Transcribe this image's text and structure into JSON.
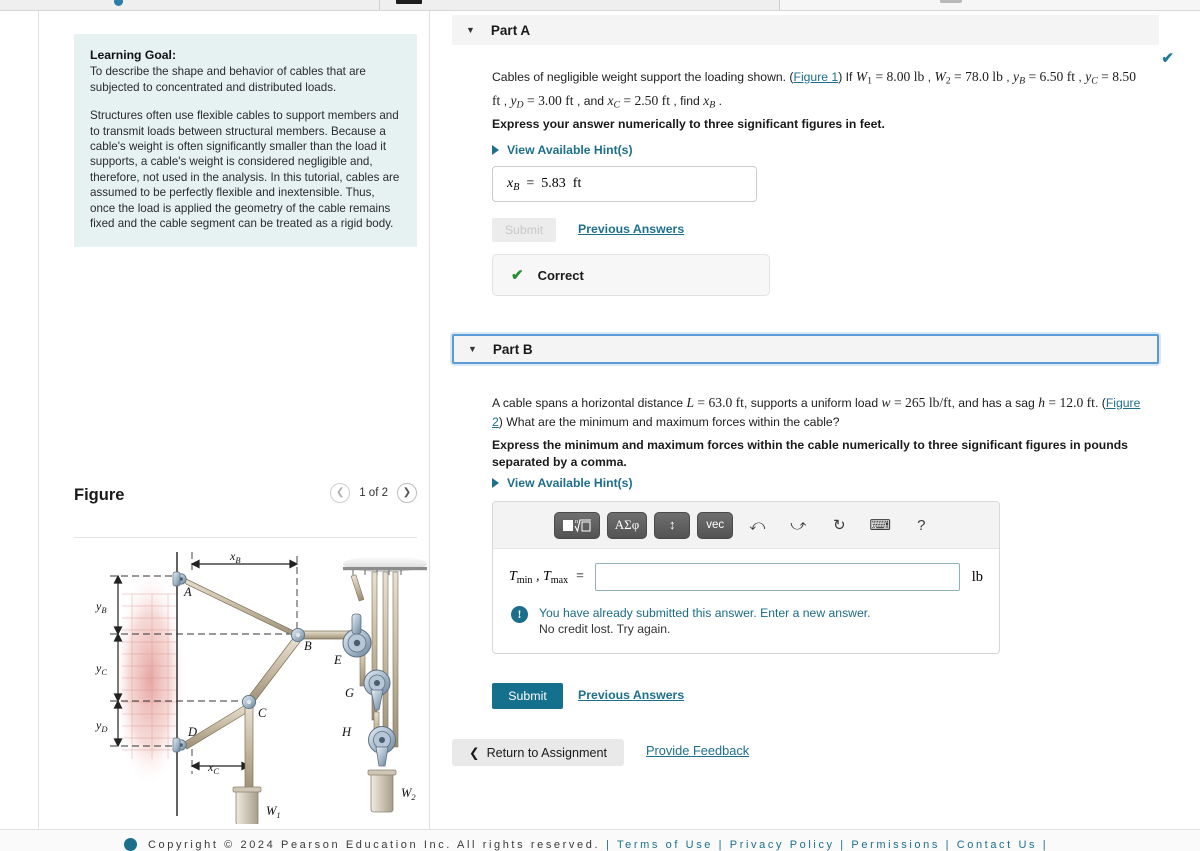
{
  "learning_goal": {
    "title": "Learning Goal:",
    "para1": "To describe the shape and behavior of cables that are subjected to concentrated and distributed loads.",
    "para2": "Structures often use flexible cables to support members and to transmit loads between structural members.  Because a cable's weight is often significantly smaller than the load it supports, a cable's weight is considered negligible and, therefore, not used in the analysis. In this tutorial, cables are assumed to be perfectly flexible and inextensible. Thus, once the load is applied the geometry of the cable remains fixed and the cable segment can be treated as a rigid body."
  },
  "figure_panel": {
    "title": "Figure",
    "counter": "1 of 2",
    "prev_icon": "chevron-left-icon",
    "next_icon": "chevron-right-icon",
    "diagram": {
      "wall_label": "brick-wall",
      "points": [
        "A",
        "B",
        "C",
        "D",
        "E",
        "G",
        "H"
      ],
      "dim_labels": [
        "xB",
        "xC",
        "yB",
        "yC",
        "yD"
      ],
      "weights": [
        "W1",
        "W2"
      ]
    }
  },
  "part_a": {
    "caret_icon": "caret-down-icon",
    "title": "Part A",
    "status_icon": "check-icon",
    "question_pre": "Cables of negligible weight support the loading shown. (",
    "figure_link": "Figure 1",
    "question_post": ") If",
    "givens": [
      {
        "sym": "W",
        "sub": "1",
        "val": "= 8.00 lb"
      },
      {
        "sym": "W",
        "sub": "2",
        "val": "= 78.0 lb"
      },
      {
        "sym": "y",
        "sub": "B",
        "val": "= 6.50 ft"
      },
      {
        "sym": "y",
        "sub": "C",
        "val": "= 8.50 ft"
      },
      {
        "sym": "y",
        "sub": "D",
        "val": "= 3.00 ft"
      }
    ],
    "and_text": ", and",
    "given_last": {
      "sym": "x",
      "sub": "C",
      "val": "= 2.50 ft"
    },
    "find_text": ", find",
    "find_sym": {
      "sym": "x",
      "sub": "B"
    },
    "instruction": "Express your answer numerically to three significant figures in feet.",
    "hint_label": "View Available Hint(s)",
    "answer_label_sym": "x",
    "answer_label_sub": "B",
    "answer_eq": "=",
    "answer_value": "5.83",
    "answer_unit": "ft",
    "submit_label": "Submit",
    "previous_answers_label": "Previous Answers",
    "result_label": "Correct"
  },
  "part_b": {
    "caret_icon": "caret-down-icon",
    "title": "Part B",
    "q_seg1": "A cable spans a horizontal distance",
    "q_L": {
      "sym": "L",
      "val": "= 63.0 ft"
    },
    "q_seg2": ", supports a uniform load",
    "q_w": {
      "sym": "w",
      "val": "= 265 lb/ft"
    },
    "q_seg3": ", and has a sag",
    "q_h": {
      "sym": "h",
      "val": "= 12.0 ft"
    },
    "q_seg4": ". (",
    "figure_link": "Figure 2",
    "q_seg5": ") What are the minimum and maximum forces within the cable?",
    "instruction": "Express the minimum and maximum forces within the cable numerically to three significant figures in pounds separated by a comma.",
    "hint_label": "View Available Hint(s)",
    "toolbar": [
      {
        "name": "template-sqrt-button",
        "label": "■√□"
      },
      {
        "name": "greek-symbols-button",
        "label": "ΑΣφ"
      },
      {
        "name": "arrows-button",
        "label": "↕"
      },
      {
        "name": "vector-button",
        "label": "vec"
      },
      {
        "name": "undo-icon",
        "label": "↶"
      },
      {
        "name": "redo-icon",
        "label": "↷"
      },
      {
        "name": "reset-icon",
        "label": "⟳"
      },
      {
        "name": "keyboard-icon",
        "label": "⌨"
      },
      {
        "name": "help-icon",
        "label": "?"
      }
    ],
    "input_label_t": "T",
    "input_label_min": "min",
    "input_label_comma": ",",
    "input_label_t2": "T",
    "input_label_max": "max",
    "input_label_eq": "=",
    "input_value": "",
    "input_placeholder": "",
    "input_unit": "lb",
    "alert_icon": "exclamation-icon",
    "alert_line1": "You have already submitted this answer. Enter a new answer.",
    "alert_line2": "No credit lost. Try again.",
    "submit_label": "Submit",
    "previous_answers_label": "Previous Answers"
  },
  "bottom_actions": {
    "return_icon": "chevron-left-icon",
    "return_label": "Return to Assignment",
    "feedback_label": "Provide Feedback"
  },
  "footer": {
    "copyright": "Copyright © 2024 Pearson Education Inc. All rights reserved.",
    "links": "| Terms of Use | Privacy Policy | Permissions | Contact Us |"
  },
  "colors": {
    "accent_teal": "#1d6f8b",
    "submit_blue": "#15708d",
    "goal_bg": "#e6f2f2",
    "correct_green": "#24913a",
    "focus_blue": "#5b9bd5"
  }
}
